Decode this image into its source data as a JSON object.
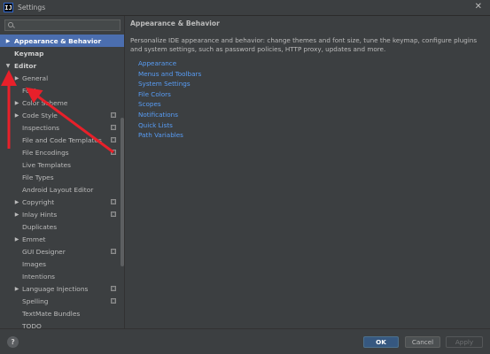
{
  "window": {
    "title": "Settings",
    "app_icon_letter": "IJ",
    "close_glyph": "✕"
  },
  "search": {
    "placeholder": "",
    "value": ""
  },
  "tree": [
    {
      "label": "Appearance & Behavior",
      "level": 0,
      "arrow": "▶",
      "selected": true,
      "bold": true,
      "project": false
    },
    {
      "label": "Keymap",
      "level": 0,
      "arrow": "",
      "selected": false,
      "bold": true,
      "project": false
    },
    {
      "label": "Editor",
      "level": 0,
      "arrow": "▼",
      "selected": false,
      "bold": true,
      "project": false
    },
    {
      "label": "General",
      "level": 1,
      "arrow": "▶",
      "selected": false,
      "bold": false,
      "project": false
    },
    {
      "label": "Font",
      "level": 1,
      "arrow": "",
      "selected": false,
      "bold": false,
      "project": false
    },
    {
      "label": "Color Scheme",
      "level": 1,
      "arrow": "▶",
      "selected": false,
      "bold": false,
      "project": false
    },
    {
      "label": "Code Style",
      "level": 1,
      "arrow": "▶",
      "selected": false,
      "bold": false,
      "project": true
    },
    {
      "label": "Inspections",
      "level": 1,
      "arrow": "",
      "selected": false,
      "bold": false,
      "project": true
    },
    {
      "label": "File and Code Templates",
      "level": 1,
      "arrow": "",
      "selected": false,
      "bold": false,
      "project": true
    },
    {
      "label": "File Encodings",
      "level": 1,
      "arrow": "",
      "selected": false,
      "bold": false,
      "project": true
    },
    {
      "label": "Live Templates",
      "level": 1,
      "arrow": "",
      "selected": false,
      "bold": false,
      "project": false
    },
    {
      "label": "File Types",
      "level": 1,
      "arrow": "",
      "selected": false,
      "bold": false,
      "project": false
    },
    {
      "label": "Android Layout Editor",
      "level": 1,
      "arrow": "",
      "selected": false,
      "bold": false,
      "project": false
    },
    {
      "label": "Copyright",
      "level": 1,
      "arrow": "▶",
      "selected": false,
      "bold": false,
      "project": true
    },
    {
      "label": "Inlay Hints",
      "level": 1,
      "arrow": "▶",
      "selected": false,
      "bold": false,
      "project": true
    },
    {
      "label": "Duplicates",
      "level": 1,
      "arrow": "",
      "selected": false,
      "bold": false,
      "project": false
    },
    {
      "label": "Emmet",
      "level": 1,
      "arrow": "▶",
      "selected": false,
      "bold": false,
      "project": false
    },
    {
      "label": "GUI Designer",
      "level": 1,
      "arrow": "",
      "selected": false,
      "bold": false,
      "project": true
    },
    {
      "label": "Images",
      "level": 1,
      "arrow": "",
      "selected": false,
      "bold": false,
      "project": false
    },
    {
      "label": "Intentions",
      "level": 1,
      "arrow": "",
      "selected": false,
      "bold": false,
      "project": false
    },
    {
      "label": "Language Injections",
      "level": 1,
      "arrow": "▶",
      "selected": false,
      "bold": false,
      "project": true
    },
    {
      "label": "Spelling",
      "level": 1,
      "arrow": "",
      "selected": false,
      "bold": false,
      "project": true
    },
    {
      "label": "TextMate Bundles",
      "level": 1,
      "arrow": "",
      "selected": false,
      "bold": false,
      "project": false
    },
    {
      "label": "TODO",
      "level": 1,
      "arrow": "",
      "selected": false,
      "bold": false,
      "project": false
    }
  ],
  "content": {
    "title": "Appearance & Behavior",
    "description": "Personalize IDE appearance and behavior: change themes and font size, tune the keymap, configure plugins and system settings, such as password policies, HTTP proxy, updates and more.",
    "links": [
      "Appearance",
      "Menus and Toolbars",
      "System Settings",
      "File Colors",
      "Scopes",
      "Notifications",
      "Quick Lists",
      "Path Variables"
    ]
  },
  "footer": {
    "help_label": "?",
    "ok_label": "OK",
    "cancel_label": "Cancel",
    "apply_label": "Apply"
  },
  "colors": {
    "background": "#3c3f41",
    "selection": "#4b6eaf",
    "link": "#589df6",
    "annotation_arrow": "#e8202a",
    "ok_button": "#365880"
  }
}
